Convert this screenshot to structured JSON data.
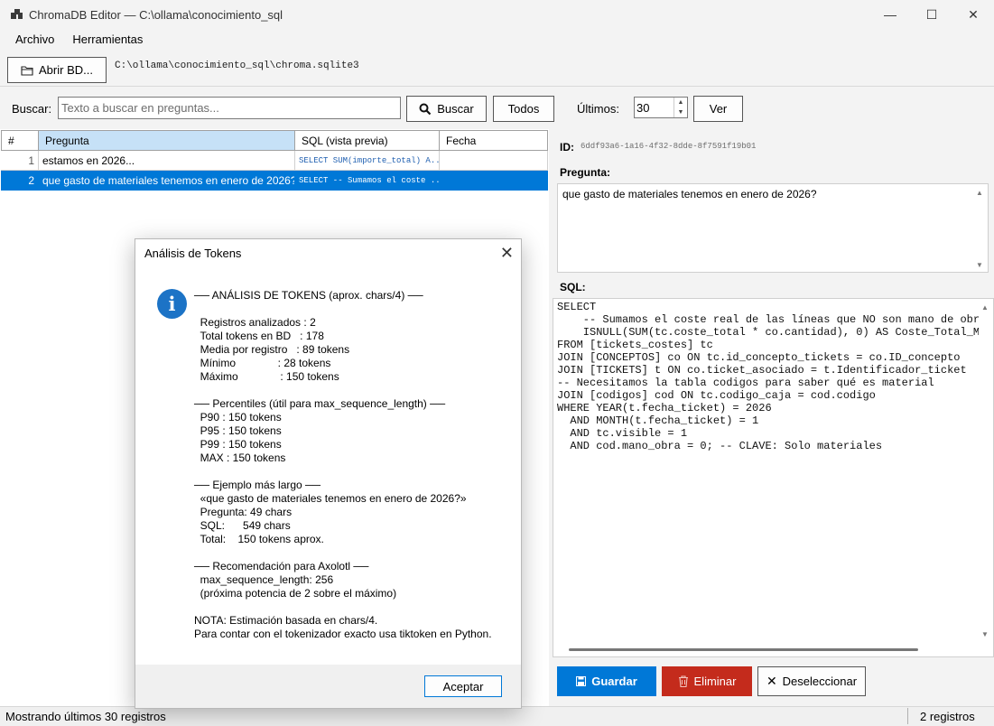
{
  "window": {
    "title": "ChromaDB Editor — C:\\ollama\\conocimiento_sql",
    "minimize": "—",
    "maximize": "☐",
    "close": "✕"
  },
  "menu": {
    "archivo": "Archivo",
    "herramientas": "Herramientas"
  },
  "toolbar": {
    "open_label": "Abrir BD...",
    "db_path": "C:\\ollama\\conocimiento_sql\\chroma.sqlite3"
  },
  "search": {
    "label": "Buscar:",
    "placeholder": "Texto a buscar en preguntas...",
    "buscar_label": "Buscar",
    "todos_label": "Todos",
    "ultimos_label": "Últimos:",
    "ultimos_value": "30",
    "ver_label": "Ver"
  },
  "grid": {
    "headers": [
      "#",
      "Pregunta",
      "SQL (vista previa)",
      "Fecha"
    ],
    "rows": [
      {
        "num": "1",
        "pregunta": "estamos en 2026...",
        "sql": "SELECT SUM(importe_total) A...",
        "fecha": ""
      },
      {
        "num": "2",
        "pregunta": "que gasto de materiales tenemos en enero de 2026?",
        "sql": "SELECT -- Sumamos el coste ...",
        "fecha": ""
      }
    ]
  },
  "detail": {
    "id_label": "ID:",
    "id_value": "6ddf93a6-1a16-4f32-8dde-8f7591f19b01",
    "pregunta_label": "Pregunta:",
    "pregunta_value": "que gasto de materiales tenemos en enero de 2026?",
    "sql_label": "SQL:",
    "sql_value": "SELECT\n    -- Sumamos el coste real de las líneas que NO son mano de obra\n    ISNULL(SUM(tc.coste_total * co.cantidad), 0) AS Coste_Total_Ma\nFROM [tickets_costes] tc\nJOIN [CONCEPTOS] co ON tc.id_concepto_tickets = co.ID_concepto\nJOIN [TICKETS] t ON co.ticket_asociado = t.Identificador_ticket\n-- Necesitamos la tabla codigos para saber qué es material\nJOIN [codigos] cod ON tc.codigo_caja = cod.codigo\nWHERE YEAR(t.fecha_ticket) = 2026\n  AND MONTH(t.fecha_ticket) = 1\n  AND tc.visible = 1\n  AND cod.mano_obra = 0; -- CLAVE: Solo materiales"
  },
  "actions": {
    "guardar": "Guardar",
    "eliminar": "Eliminar",
    "deseleccionar": "Deseleccionar"
  },
  "status": {
    "left": "Mostrando últimos 30 registros",
    "right": "2 registros"
  },
  "colors": {
    "accent": "#0078d7",
    "danger": "#c42b1c",
    "info": "#1c73c6"
  },
  "dialog": {
    "title": "Análisis de Tokens",
    "body": "── ANÁLISIS DE TOKENS (aprox. chars/4) ──\n\n  Registros analizados : 2\n  Total tokens en BD   : 178\n  Media por registro   : 89 tokens\n  Mínimo              : 28 tokens\n  Máximo              : 150 tokens\n\n── Percentiles (útil para max_sequence_length) ──\n  P90 : 150 tokens\n  P95 : 150 tokens\n  P99 : 150 tokens\n  MAX : 150 tokens\n\n── Ejemplo más largo ──\n  «que gasto de materiales tenemos en enero de 2026?»\n  Pregunta: 49 chars\n  SQL:      549 chars\n  Total:    150 tokens aprox.\n\n── Recomendación para Axolotl ──\n  max_sequence_length: 256\n  (próxima potencia de 2 sobre el máximo)\n\nNOTA: Estimación basada en chars/4.\nPara contar con el tokenizador exacto usa tiktoken en Python.",
    "ok_label": "Aceptar"
  }
}
